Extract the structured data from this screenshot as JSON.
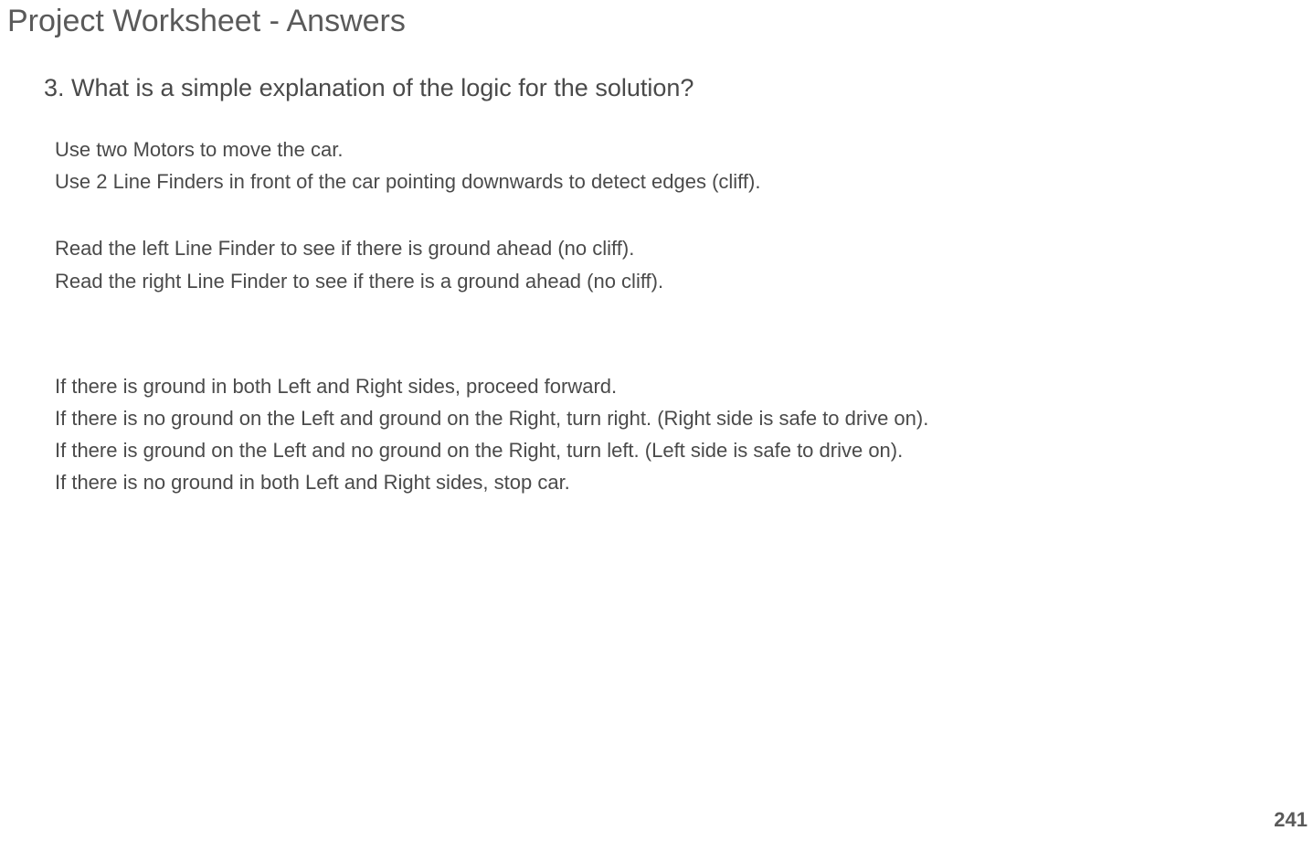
{
  "title": "Project Worksheet - Answers",
  "question": "3. What is a simple explanation of the logic for the solution?",
  "answer": {
    "group1": [
      "Use two Motors to move the car.",
      "Use 2 Line Finders in front of the car pointing downwards to detect edges (cliff)."
    ],
    "group2": [
      "Read the left Line Finder to see if there is ground ahead (no cliff).",
      "Read the right Line Finder to see if there is a ground ahead (no cliff)."
    ],
    "group3": [
      "If there is ground in both Left and Right sides, proceed forward.",
      "If there is no ground on the Left and ground on the Right, turn right. (Right side is safe to drive on).",
      "If there is ground on the Left and no ground on the Right, turn left. (Left side is safe to drive on).",
      "If there is no ground in both Left and Right sides, stop car."
    ]
  },
  "pageNumber": "241"
}
